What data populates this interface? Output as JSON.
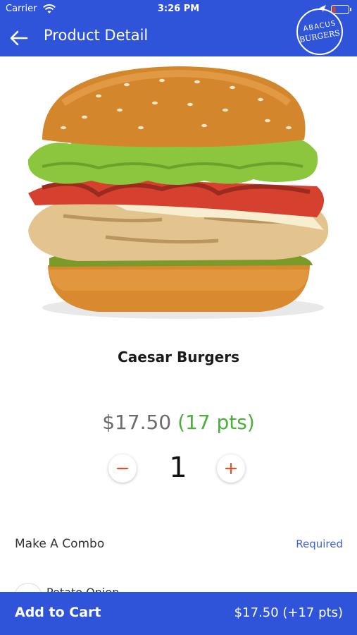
{
  "status_bar": {
    "carrier": "Carrier",
    "time": "3:26 PM"
  },
  "header": {
    "title": "Product Detail",
    "back_icon": "arrow-left-icon",
    "background": "#2f54d9"
  },
  "logo": {
    "line1": "ABACUS",
    "line2": "BURGERS"
  },
  "product": {
    "name": "Caesar Burgers",
    "price": "$17.50",
    "points": "(17 pts)",
    "quantity": "1",
    "image": "burger-photo"
  },
  "options": {
    "combo_label": "Make A Combo",
    "combo_status": "Required",
    "partial_option_text": "Potato Onion"
  },
  "bottom_bar": {
    "add_label": "Add to Cart",
    "total": "$17.50 (+17 pts)"
  },
  "colors": {
    "accent": "#2f54d9",
    "points": "#4caf3a",
    "stepper": "#e0502c"
  }
}
